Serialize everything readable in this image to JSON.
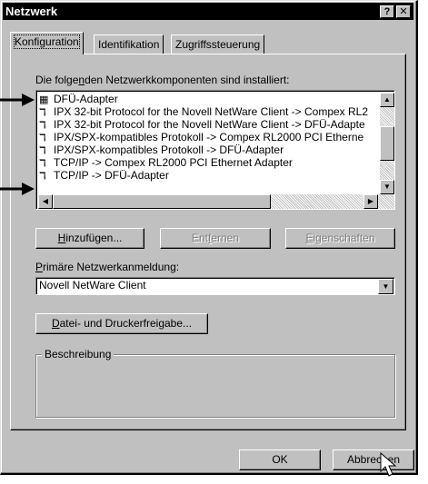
{
  "window": {
    "title": "Netzwerk",
    "help_label": "?",
    "close_label": "✕"
  },
  "tabs": [
    {
      "label": "Konfiguration",
      "active": true
    },
    {
      "label": "Identifikation",
      "active": false
    },
    {
      "label": "Zugriffssteuerung",
      "active": false
    }
  ],
  "components": {
    "label_pre": "Die folge",
    "label_accel": "n",
    "label_post": "den Netzwerkkomponenten sind installiert:",
    "items": [
      {
        "icon": "adapter-icon",
        "text": "DFÜ-Adapter"
      },
      {
        "icon": "protocol-icon",
        "text": "IPX 32-bit Protocol for the Novell NetWare Client -> Compex RL2"
      },
      {
        "icon": "protocol-icon",
        "text": "IPX 32-bit Protocol for the Novell NetWare Client -> DFÜ-Adapte"
      },
      {
        "icon": "protocol-icon",
        "text": "IPX/SPX-kompatibles Protokoll -> Compex RL2000 PCI Etherne"
      },
      {
        "icon": "protocol-icon",
        "text": "IPX/SPX-kompatibles Protokoll -> DFÜ-Adapter"
      },
      {
        "icon": "protocol-icon",
        "text": "TCP/IP -> Compex RL2000 PCI Ethernet Adapter"
      },
      {
        "icon": "protocol-icon",
        "text": "TCP/IP -> DFÜ-Adapter"
      }
    ]
  },
  "buttons": {
    "add_accel": "H",
    "add_rest": "inzufügen...",
    "remove_pre": "Ent",
    "remove_accel": "f",
    "remove_post": "ernen",
    "props_accel": "E",
    "props_rest": "igenschaften",
    "sharing_accel": "D",
    "sharing_rest": "atei- und Druckerfreigabe...",
    "ok": "OK",
    "cancel": "Abbrechen"
  },
  "primary_logon": {
    "label_accel": "P",
    "label_rest": "rimäre Netzwerkanmeldung:",
    "value": "Novell NetWare Client"
  },
  "description": {
    "title": "Beschreibung",
    "text": ""
  }
}
